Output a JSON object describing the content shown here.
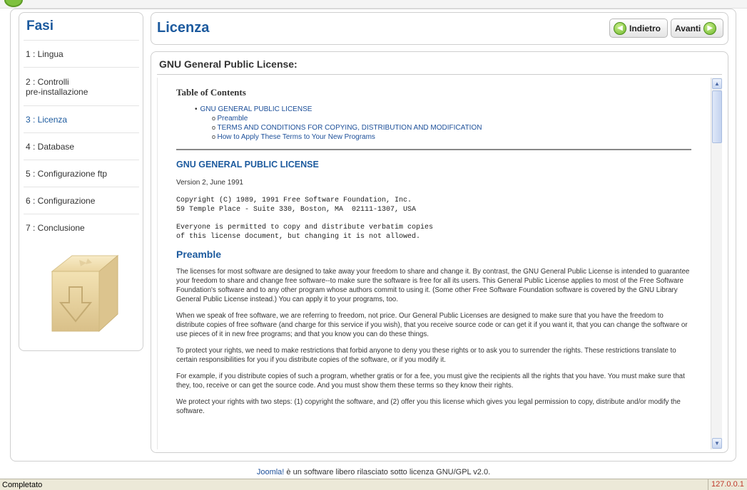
{
  "sidebar": {
    "title": "Fasi",
    "steps": [
      {
        "label": "1 : Lingua",
        "active": false
      },
      {
        "label": "2 : Controlli\npre-installazione",
        "active": false
      },
      {
        "label": "3 : Licenza",
        "active": true
      },
      {
        "label": "4 : Database",
        "active": false
      },
      {
        "label": "5 : Configurazione ftp",
        "active": false
      },
      {
        "label": "6 : Configurazione",
        "active": false
      },
      {
        "label": "7 : Conclusione",
        "active": false
      }
    ]
  },
  "header": {
    "title": "Licenza",
    "back_label": "Indietro",
    "next_label": "Avanti"
  },
  "license": {
    "heading": "GNU General Public License:",
    "toc_title": "Table of Contents",
    "toc_main": "GNU GENERAL PUBLIC LICENSE",
    "toc_items": [
      "Preamble",
      "TERMS AND CONDITIONS FOR COPYING, DISTRIBUTION AND MODIFICATION",
      "How to Apply These Terms to Your New Programs"
    ],
    "section_title": "GNU GENERAL PUBLIC LICENSE",
    "version": "Version 2, June 1991",
    "copyright": "Copyright (C) 1989, 1991 Free Software Foundation, Inc.\n59 Temple Place - Suite 330, Boston, MA  02111-1307, USA",
    "permission": "Everyone is permitted to copy and distribute verbatim copies\nof this license document, but changing it is not allowed.",
    "preamble_title": "Preamble",
    "paragraphs": [
      "The licenses for most software are designed to take away your freedom to share and change it. By contrast, the GNU General Public License is intended to guarantee your freedom to share and change free software--to make sure the software is free for all its users. This General Public License applies to most of the Free Software Foundation's software and to any other program whose authors commit to using it. (Some other Free Software Foundation software is covered by the GNU Library General Public License instead.) You can apply it to your programs, too.",
      "When we speak of free software, we are referring to freedom, not price. Our General Public Licenses are designed to make sure that you have the freedom to distribute copies of free software (and charge for this service if you wish), that you receive source code or can get it if you want it, that you can change the software or use pieces of it in new free programs; and that you know you can do these things.",
      "To protect your rights, we need to make restrictions that forbid anyone to deny you these rights or to ask you to surrender the rights. These restrictions translate to certain responsibilities for you if you distribute copies of the software, or if you modify it.",
      "For example, if you distribute copies of such a program, whether gratis or for a fee, you must give the recipients all the rights that you have. You must make sure that they, too, receive or can get the source code. And you must show them these terms so they know their rights.",
      "We protect your rights with two steps: (1) copyright the software, and (2) offer you this license which gives you legal permission to copy, distribute and/or modify the software."
    ]
  },
  "footer": {
    "link": "Joomla!",
    "text": " è un software libero rilasciato sotto licenza GNU/GPL v2.0."
  },
  "status_bar": {
    "left": "Completato",
    "right": "127.0.0.1"
  },
  "colors": {
    "accent_blue": "#1c5a9e",
    "link_blue": "#1c4f99",
    "button_green": "#6cb52a"
  }
}
